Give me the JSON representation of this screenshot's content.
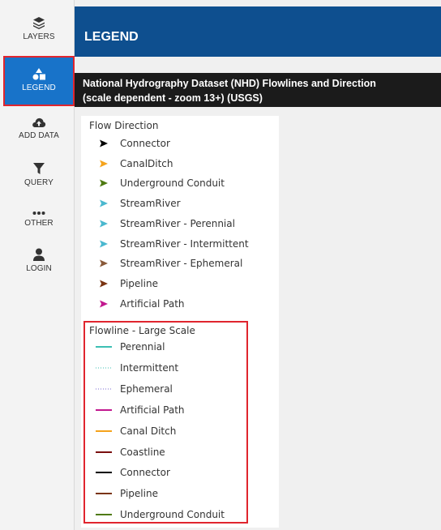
{
  "nav": {
    "layers": "LAYERS",
    "legend": "LEGEND",
    "add_data": "ADD DATA",
    "query": "QUERY",
    "other": "OTHER",
    "login": "LOGIN"
  },
  "header": {
    "title": "LEGEND"
  },
  "layer": {
    "title_line1": "National Hydrography Dataset (NHD) Flowlines and Direction",
    "title_line2": "(scale dependent - zoom 13+) (USGS)"
  },
  "flow_direction": {
    "title": "Flow Direction",
    "items": [
      {
        "label": "Connector",
        "color": "#000000"
      },
      {
        "label": "CanalDitch",
        "color": "#f5a31c"
      },
      {
        "label": "Underground Conduit",
        "color": "#4f7a12"
      },
      {
        "label": "StreamRiver",
        "color": "#4ab8cf"
      },
      {
        "label": "StreamRiver - Perennial",
        "color": "#4ab8cf"
      },
      {
        "label": "StreamRiver - Intermittent",
        "color": "#4ab8cf"
      },
      {
        "label": "StreamRiver - Ephemeral",
        "color": "#8a5a3a"
      },
      {
        "label": "Pipeline",
        "color": "#7a3412"
      },
      {
        "label": "Artificial Path",
        "color": "#c2188f"
      }
    ]
  },
  "flowline_large": {
    "title": "Flowline - Large Scale",
    "items": [
      {
        "label": "Perennial",
        "color": "#3cbfb3",
        "style": "solid"
      },
      {
        "label": "Intermittent",
        "color": "#3cbfb3",
        "style": "dotted"
      },
      {
        "label": "Ephemeral",
        "color": "#7a6ad0",
        "style": "dotted"
      },
      {
        "label": "Artificial Path",
        "color": "#c2188f",
        "style": "solid"
      },
      {
        "label": "Canal Ditch",
        "color": "#f5a31c",
        "style": "solid"
      },
      {
        "label": "Coastline",
        "color": "#7a0f0f",
        "style": "solid"
      },
      {
        "label": "Connector",
        "color": "#000000",
        "style": "solid"
      },
      {
        "label": "Pipeline",
        "color": "#7a3412",
        "style": "solid"
      },
      {
        "label": "Underground Conduit",
        "color": "#4f7a12",
        "style": "solid"
      }
    ]
  }
}
